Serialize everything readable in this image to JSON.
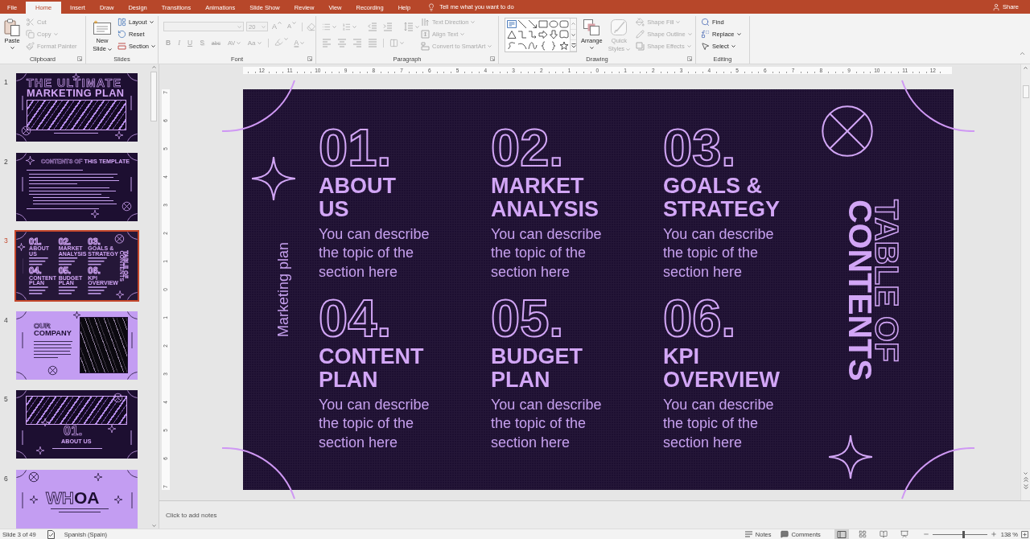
{
  "tab_bar": {
    "tabs": [
      {
        "label": "File",
        "selected": false
      },
      {
        "label": "Home",
        "selected": true
      },
      {
        "label": "Insert",
        "selected": false
      },
      {
        "label": "Draw",
        "selected": false
      },
      {
        "label": "Design",
        "selected": false
      },
      {
        "label": "Transitions",
        "selected": false
      },
      {
        "label": "Animations",
        "selected": false
      },
      {
        "label": "Slide Show",
        "selected": false
      },
      {
        "label": "Review",
        "selected": false
      },
      {
        "label": "View",
        "selected": false
      },
      {
        "label": "Recording",
        "selected": false
      },
      {
        "label": "Help",
        "selected": false
      }
    ],
    "tell_me": {
      "placeholder": "Tell me what you want to do"
    },
    "share": "Share"
  },
  "ribbon": {
    "groups": [
      {
        "label": "Clipboard",
        "launcher": true,
        "large": [
          {
            "lines": [
              "Paste"
            ],
            "menu": true,
            "disabled": false
          }
        ],
        "small": [
          {
            "label": "Cut",
            "menu": false,
            "disabled": true
          },
          {
            "label": "Copy",
            "menu": true,
            "disabled": true
          },
          {
            "label": "Format Painter",
            "menu": false,
            "disabled": true
          }
        ]
      },
      {
        "label": "Slides",
        "launcher": false,
        "large": [
          {
            "lines": [
              "New",
              "Slide"
            ],
            "menu": true,
            "disabled": false
          }
        ],
        "small": [
          {
            "label": "Layout",
            "menu": true,
            "disabled": false
          },
          {
            "label": "Reset",
            "menu": false,
            "disabled": false
          },
          {
            "label": "Section",
            "menu": true,
            "disabled": false
          }
        ]
      },
      {
        "label": "Font",
        "launcher": true,
        "disabled": true,
        "font_size": "20",
        "size_buttons": [
          "A",
          "A"
        ],
        "format_buttons": [
          {
            "label": "B",
            "menu": false
          },
          {
            "label": "I",
            "menu": false
          },
          {
            "label": "U",
            "menu": false
          },
          {
            "label": "S",
            "menu": false
          },
          {
            "label": "abc",
            "menu": false
          },
          {
            "label": "AV",
            "menu": true
          },
          {
            "label": "Aa",
            "menu": true
          }
        ],
        "font_color": "A"
      },
      {
        "label": "Paragraph",
        "launcher": true,
        "icons_disabled": true,
        "small": [
          {
            "label": "Text Direction",
            "menu": true,
            "disabled": true
          },
          {
            "label": "Align Text",
            "menu": true,
            "disabled": true
          },
          {
            "label": "Convert to SmartArt",
            "menu": true,
            "disabled": true
          }
        ]
      },
      {
        "label": "Drawing",
        "launcher": true,
        "large": [
          {
            "lines": [
              "Arrange"
            ],
            "menu": true,
            "disabled": false
          },
          {
            "lines": [
              "Quick",
              "Styles"
            ],
            "menu": true,
            "disabled": true
          }
        ],
        "small": [
          {
            "label": "Shape Fill",
            "menu": true,
            "disabled": true
          },
          {
            "label": "Shape Outline",
            "menu": true,
            "disabled": true
          },
          {
            "label": "Shape Effects",
            "menu": true,
            "disabled": true
          }
        ]
      },
      {
        "label": "Editing",
        "launcher": false,
        "small": [
          {
            "label": "Find",
            "menu": false,
            "disabled": false
          },
          {
            "label": "Replace",
            "menu": true,
            "disabled": false
          },
          {
            "label": "Select",
            "menu": true,
            "disabled": false
          }
        ]
      }
    ]
  },
  "slide_pane": {
    "slides": [
      {
        "number": "1",
        "selected": false,
        "kind": "title",
        "heading_outline": "THE ULTIMATE",
        "heading_filled": "MARKETING PLAN"
      },
      {
        "number": "2",
        "selected": false,
        "kind": "contents",
        "heading_outline": "CONTENTS OF",
        "heading_filled": "THIS TEMPLATE"
      },
      {
        "number": "3",
        "selected": true,
        "kind": "toc",
        "heading_outline": "TABLE OF",
        "heading_filled": "CONTENTS",
        "items": [
          {
            "number": "01.",
            "title_lines": [
              "ABOUT",
              "US"
            ]
          },
          {
            "number": "02.",
            "title_lines": [
              "MARKET",
              "ANALYSIS"
            ]
          },
          {
            "number": "03.",
            "title_lines": [
              "GOALS &",
              "STRATEGY"
            ]
          },
          {
            "number": "04.",
            "title_lines": [
              "CONTENT",
              "PLAN"
            ]
          },
          {
            "number": "05.",
            "title_lines": [
              "BUDGET",
              "PLAN"
            ]
          },
          {
            "number": "06.",
            "title_lines": [
              "KPI",
              "OVERVIEW"
            ]
          }
        ]
      },
      {
        "number": "4",
        "selected": false,
        "kind": "company",
        "heading_outline": "OUR",
        "heading_filled": "COMPANY"
      },
      {
        "number": "5",
        "selected": false,
        "kind": "section",
        "heading_outline": "01.",
        "heading_filled": "ABOUT US"
      },
      {
        "number": "6",
        "selected": false,
        "kind": "statement",
        "heading_outline": "WH",
        "heading_filled": "OA"
      }
    ]
  },
  "rulers": {
    "horizontal": [
      "12",
      "11",
      "10",
      "9",
      "8",
      "7",
      "6",
      "5",
      "4",
      "3",
      "2",
      "1",
      "0",
      "1",
      "2",
      "3",
      "4",
      "5",
      "6",
      "7",
      "8",
      "9",
      "10",
      "11",
      "12"
    ],
    "vertical": [
      "7",
      "6",
      "5",
      "4",
      "3",
      "2",
      "1",
      "0",
      "1",
      "2",
      "3",
      "4",
      "5",
      "6",
      "7"
    ]
  },
  "slide": {
    "side_label": "Marketing plan",
    "heading_outline": "TABLE OF",
    "heading_filled": "CONTENTS",
    "items": [
      {
        "number": "01.",
        "title_lines": [
          "ABOUT",
          "US"
        ],
        "description": "You can describe the topic of the section here"
      },
      {
        "number": "02.",
        "title_lines": [
          "MARKET",
          "ANALYSIS"
        ],
        "description": "You can describe the topic of the section here"
      },
      {
        "number": "03.",
        "title_lines": [
          "GOALS &",
          "STRATEGY"
        ],
        "description": "You can describe the topic of the section here"
      },
      {
        "number": "04.",
        "title_lines": [
          "CONTENT",
          "PLAN"
        ],
        "description": "You can describe the topic of the section here"
      },
      {
        "number": "05.",
        "title_lines": [
          "BUDGET",
          "PLAN"
        ],
        "description": "You can describe the topic of the section here"
      },
      {
        "number": "06.",
        "title_lines": [
          "KPI",
          "OVERVIEW"
        ],
        "description": "You can describe the topic of the section here"
      }
    ]
  },
  "notes": {
    "placeholder": "Click to add notes"
  },
  "status_bar": {
    "slide_position": "Slide 3 of 49",
    "language": "Spanish (Spain)",
    "notes": "Notes",
    "comments": "Comments",
    "views": [
      {
        "selected": true
      },
      {
        "selected": false
      },
      {
        "selected": false
      },
      {
        "selected": false
      }
    ],
    "zoom": {
      "level": 0.57,
      "label": "138 %"
    }
  }
}
